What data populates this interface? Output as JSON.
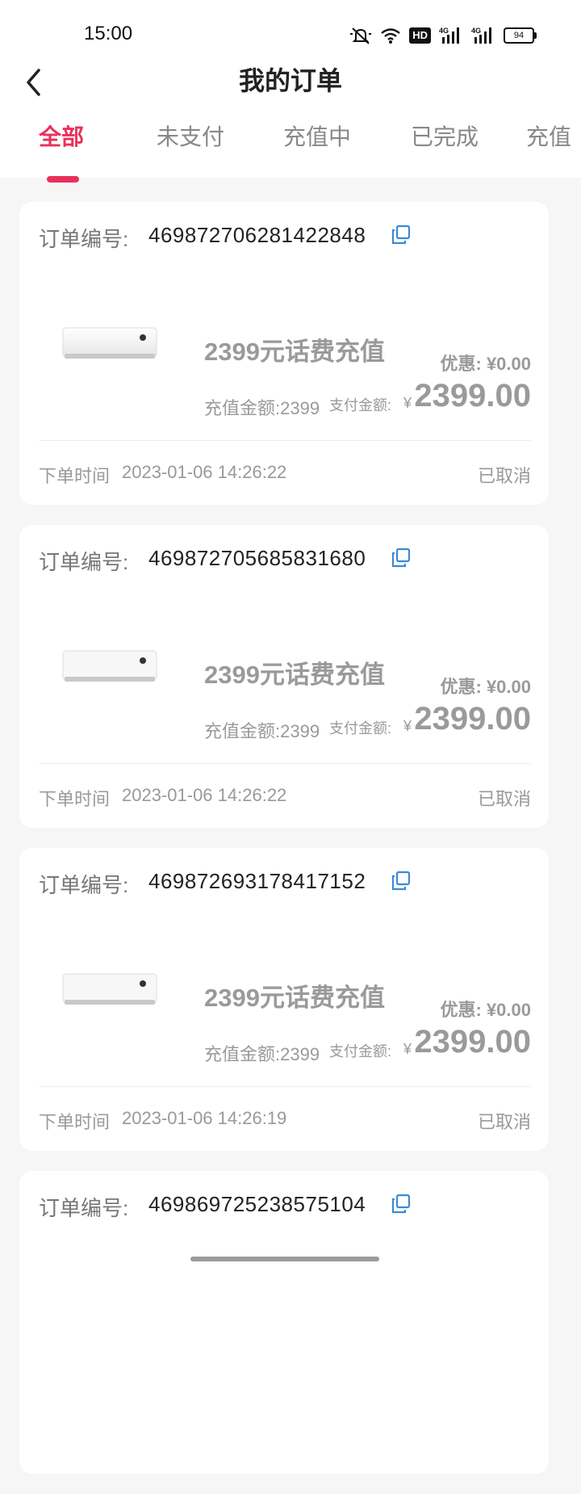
{
  "status_bar": {
    "time": "15:00",
    "network_hd": "HD",
    "sim1": "4G",
    "sim2": "4G",
    "battery": "94"
  },
  "header": {
    "title": "我的订单"
  },
  "tabs": [
    {
      "label": "全部",
      "active": true
    },
    {
      "label": "未支付",
      "active": false
    },
    {
      "label": "充值中",
      "active": false
    },
    {
      "label": "已完成",
      "active": false
    },
    {
      "label": "充值",
      "active": false
    }
  ],
  "order_labels": {
    "order_no": "订单编号:",
    "recharge_amount": "充值金额:2399",
    "pay_amount": "支付金额:",
    "currency": "¥",
    "order_time": "下单时间"
  },
  "orders": [
    {
      "order_no": "469872706281422848",
      "product_name": "2399元话费充值",
      "discount": "优惠: ¥0.00",
      "pay_amount": "2399.00",
      "order_time": "2023-01-06 14:26:22",
      "status": "已取消"
    },
    {
      "order_no": "469872705685831680",
      "product_name": "2399元话费充值",
      "discount": "优惠: ¥0.00",
      "pay_amount": "2399.00",
      "order_time": "2023-01-06 14:26:22",
      "status": "已取消"
    },
    {
      "order_no": "469872693178417152",
      "product_name": "2399元话费充值",
      "discount": "优惠: ¥0.00",
      "pay_amount": "2399.00",
      "order_time": "2023-01-06 14:26:19",
      "status": "已取消"
    },
    {
      "order_no": "469869725238575104"
    }
  ],
  "colors": {
    "accent": "#e8315a",
    "copy_icon": "#3a8ad6"
  }
}
